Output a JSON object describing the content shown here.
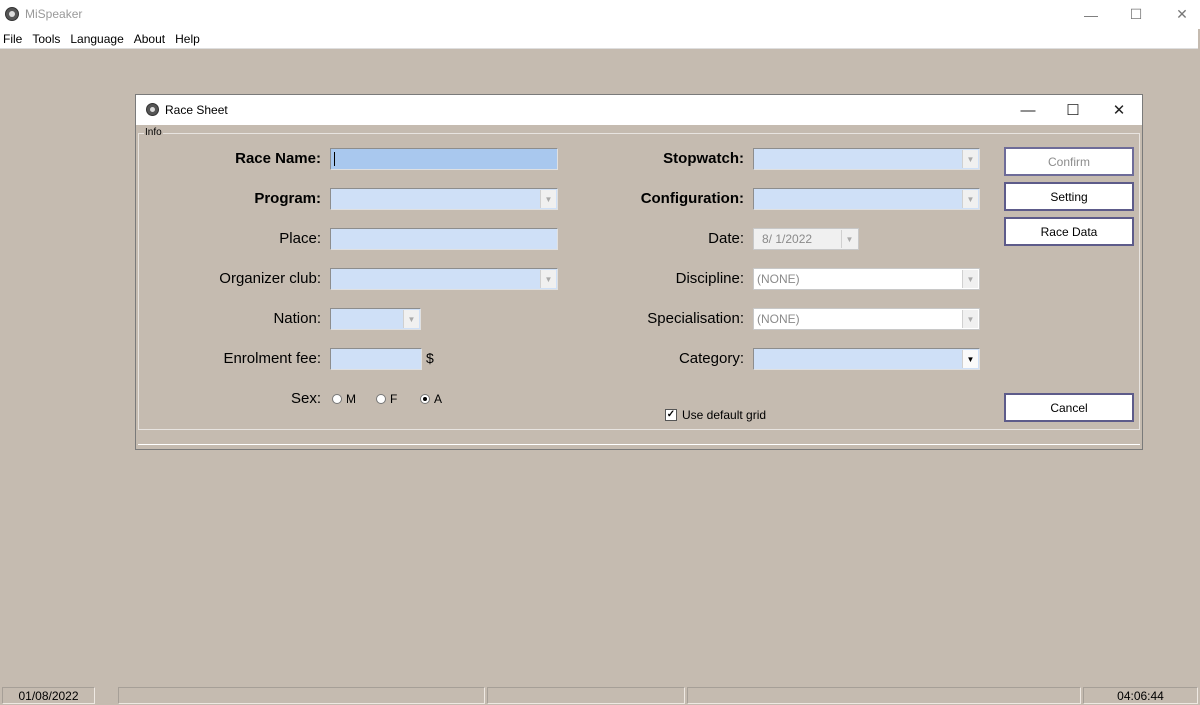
{
  "app": {
    "title": "MiSpeaker",
    "controls": {
      "minimize": "—",
      "maximize": "☐",
      "close": "✕"
    }
  },
  "menu": [
    "File",
    "Tools",
    "Language",
    "About",
    "Help"
  ],
  "dialog": {
    "title": "Race Sheet",
    "group_label": "Info",
    "labels": {
      "race_name": "Race Name:",
      "program": "Program:",
      "place": "Place:",
      "organizer_club": "Organizer club:",
      "nation": "Nation:",
      "enrolment_fee": "Enrolment fee:",
      "sex": "Sex:",
      "stopwatch": "Stopwatch:",
      "configuration": "Configuration:",
      "date": "Date:",
      "discipline": "Discipline:",
      "specialisation": "Specialisation:",
      "category": "Category:"
    },
    "values": {
      "race_name": "",
      "place": "",
      "enrolment_fee": "",
      "date": "8/ 1/2022",
      "discipline": "(NONE)",
      "specialisation": "(NONE)"
    },
    "currency": "$",
    "sex_options": [
      {
        "label": "M",
        "checked": false
      },
      {
        "label": "F",
        "checked": false
      },
      {
        "label": "A",
        "checked": true
      }
    ],
    "use_default_grid": {
      "label": "Use default grid",
      "checked": true
    },
    "buttons": {
      "confirm": "Confirm",
      "setting": "Setting",
      "race_data": "Race Data",
      "cancel": "Cancel"
    }
  },
  "status": {
    "date": "01/08/2022",
    "time": "04:06:44"
  },
  "colors": {
    "background": "#c5bbb0",
    "field_bg": "#cfe0f7",
    "button_border": "#5d5b8a"
  }
}
